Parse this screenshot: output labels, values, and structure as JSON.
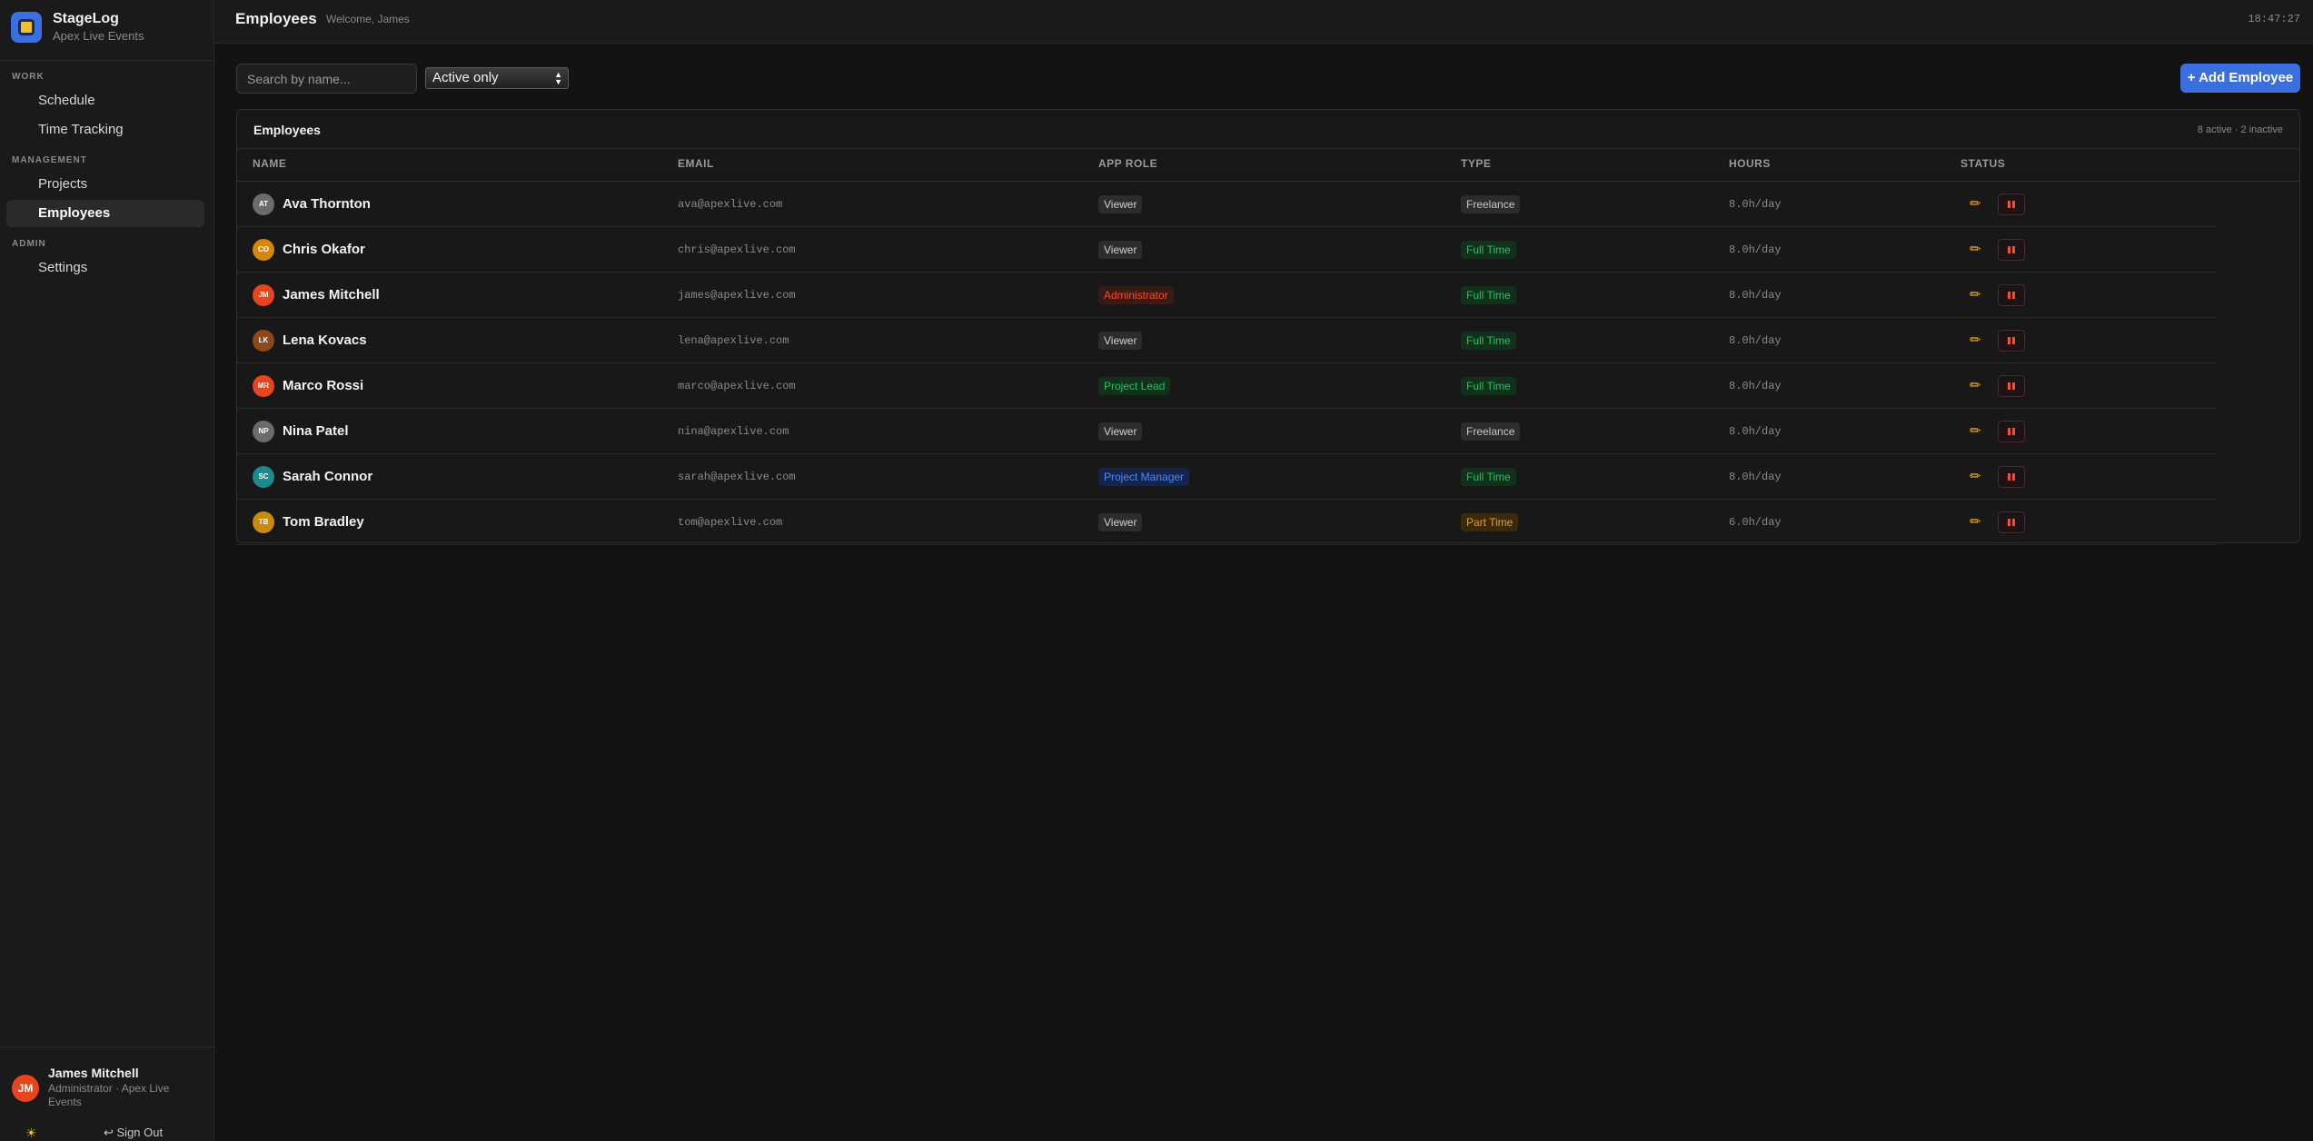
{
  "brand": {
    "name": "StageLog",
    "org": "Apex Live Events"
  },
  "nav": {
    "sections": [
      {
        "label": "WORK",
        "items": [
          {
            "label": "Schedule"
          },
          {
            "label": "Time Tracking"
          }
        ]
      },
      {
        "label": "MANAGEMENT",
        "items": [
          {
            "label": "Projects"
          },
          {
            "label": "Employees",
            "active": true
          }
        ]
      },
      {
        "label": "ADMIN",
        "items": [
          {
            "label": "Settings"
          }
        ]
      }
    ]
  },
  "user": {
    "initials": "JM",
    "name": "James Mitchell",
    "role": "Administrator · Apex Live Events",
    "theme_icon": "sun-icon",
    "signout": "↩ Sign Out"
  },
  "header": {
    "title": "Employees",
    "welcome": "Welcome, James",
    "clock": "18:47:27"
  },
  "toolbar": {
    "search_placeholder": "Search by name...",
    "filter_value": "Active only",
    "add_label": "+ Add Employee"
  },
  "table": {
    "title": "Employees",
    "count": "8 active · 2 inactive",
    "columns": [
      "NAME",
      "EMAIL",
      "APP ROLE",
      "TYPE",
      "HOURS",
      "STATUS"
    ],
    "rows": [
      {
        "initials": "AT",
        "avatar_color": "#6b6b6b",
        "name": "Ava Thornton",
        "email": "ava@apexlive.com",
        "role": "Viewer",
        "type": "Freelance",
        "hours": "8.0h/day"
      },
      {
        "initials": "CO",
        "avatar_color": "#d4870a",
        "name": "Chris Okafor",
        "email": "chris@apexlive.com",
        "role": "Viewer",
        "type": "Full Time",
        "hours": "8.0h/day"
      },
      {
        "initials": "JM",
        "avatar_color": "#e8441e",
        "name": "James Mitchell",
        "email": "james@apexlive.com",
        "role": "Administrator",
        "type": "Full Time",
        "hours": "8.0h/day"
      },
      {
        "initials": "LK",
        "avatar_color": "#8a4a1a",
        "name": "Lena Kovacs",
        "email": "lena@apexlive.com",
        "role": "Viewer",
        "type": "Full Time",
        "hours": "8.0h/day"
      },
      {
        "initials": "MR",
        "avatar_color": "#e8441e",
        "name": "Marco Rossi",
        "email": "marco@apexlive.com",
        "role": "Project Lead",
        "type": "Full Time",
        "hours": "8.0h/day"
      },
      {
        "initials": "NP",
        "avatar_color": "#6b6b6b",
        "name": "Nina Patel",
        "email": "nina@apexlive.com",
        "role": "Viewer",
        "type": "Freelance",
        "hours": "8.0h/day"
      },
      {
        "initials": "SC",
        "avatar_color": "#1a8a8a",
        "name": "Sarah Connor",
        "email": "sarah@apexlive.com",
        "role": "Project Manager",
        "type": "Full Time",
        "hours": "8.0h/day"
      },
      {
        "initials": "TB",
        "avatar_color": "#c98a10",
        "name": "Tom Bradley",
        "email": "tom@apexlive.com",
        "role": "Viewer",
        "type": "Part Time",
        "hours": "6.0h/day"
      }
    ]
  },
  "colors": {
    "accent": "#3b6fe0",
    "role_viewer": "#d0d0d0",
    "role_admin": "#ff4a2a",
    "role_lead": "#22c55e",
    "role_manager": "#4a8aff",
    "type_fulltime": "#22c55e",
    "type_freelance": "#c8c8c8",
    "type_parttime": "#f59e0b"
  },
  "icons": {
    "edit": "pencil-icon",
    "deactivate": "pause-icon"
  }
}
